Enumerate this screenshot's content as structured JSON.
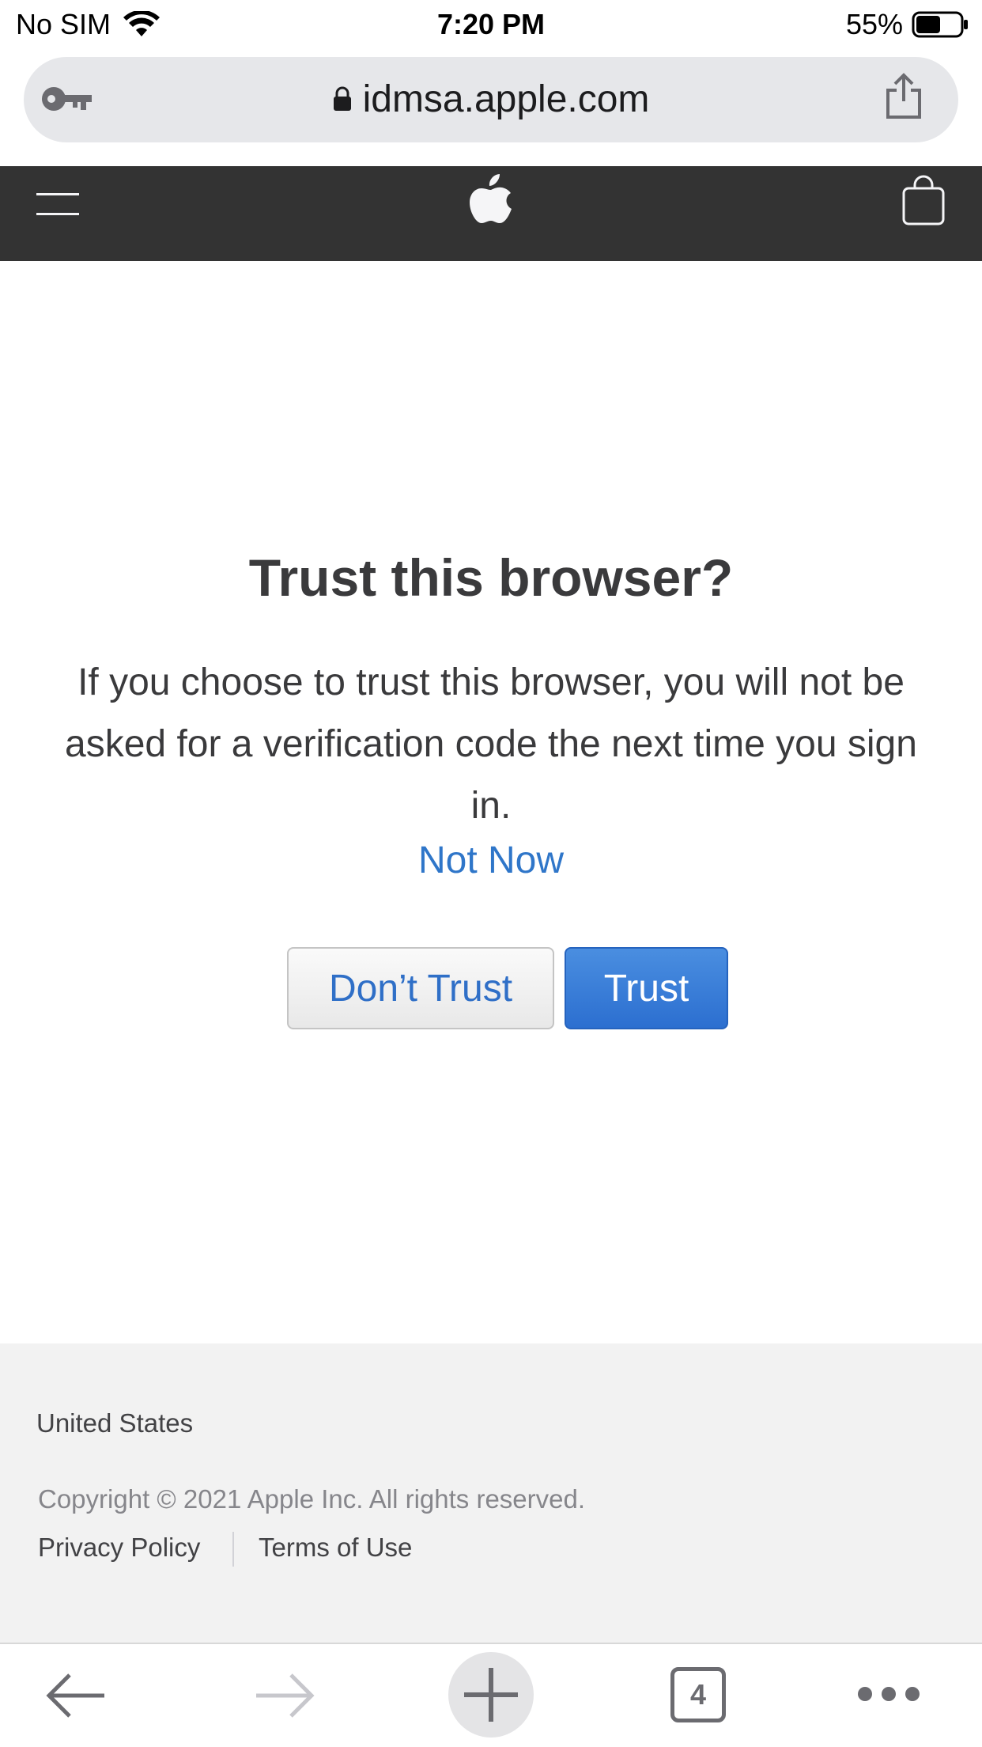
{
  "status_bar": {
    "carrier": "No SIM",
    "time": "7:20 PM",
    "battery_percent": "55%",
    "battery_level": 0.55
  },
  "browser": {
    "url": "idmsa.apple.com",
    "icons": [
      "key-icon",
      "lock-icon",
      "share-icon"
    ]
  },
  "nav": {
    "icons": [
      "menu-icon",
      "apple-logo-icon",
      "bag-icon"
    ],
    "background": "#333333"
  },
  "dialog": {
    "title": "Trust this browser?",
    "message": "If you choose to trust this browser, you will not be asked for a verification code the next time you sign in.",
    "not_now_label": "Not Now",
    "dont_trust_label": "Don’t Trust",
    "trust_label": "Trust",
    "link_color": "#2f76c9",
    "primary_color": "#2c6fd0"
  },
  "footer": {
    "country": "United States",
    "copyright": "Copyright © 2021 Apple Inc. All rights reserved.",
    "privacy_label": "Privacy Policy",
    "terms_label": "Terms of Use"
  },
  "toolbar": {
    "tab_count": "4",
    "icons": [
      "back-arrow-icon",
      "forward-arrow-icon",
      "plus-icon",
      "tabs-icon",
      "more-icon"
    ]
  }
}
